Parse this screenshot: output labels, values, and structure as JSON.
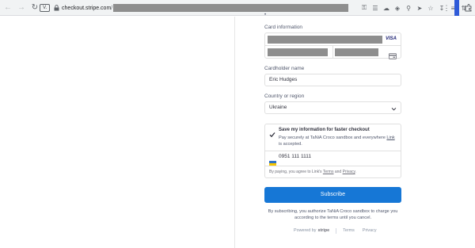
{
  "browser": {
    "site_badge": "V.",
    "url_host": "checkout.stripe.com",
    "url_tail": "/"
  },
  "form": {
    "card_label": "Card information",
    "brand_visa": "VISA",
    "cardholder_label": "Cardholder name",
    "cardholder_value": "Eric Hudges",
    "country_label": "Country or region",
    "country_value": "Ukraine",
    "link": {
      "save_title": "Save my information for faster checkout",
      "desc_before": "Pay securely at TaNiA Croco sandbox and everywhere ",
      "desc_link": "Link",
      "desc_after": " is accepted.",
      "phone": "0951 111 1111",
      "agree_before": "By paying, you agree to Link's ",
      "agree_terms": "Terms",
      "agree_and": " and ",
      "agree_privacy": "Privacy",
      "agree_end": "."
    },
    "subscribe_label": "Subscribe",
    "disclaimer": "By subscribing, you authorize TaNiA Croco sandbox to charge you according to the terms until you cancel."
  },
  "footer": {
    "powered_by": "Powered by",
    "stripe": "stripe",
    "terms": "Terms",
    "privacy": "Privacy"
  },
  "colors": {
    "accent": "#1677d6",
    "profile": "#2f5bd8"
  }
}
